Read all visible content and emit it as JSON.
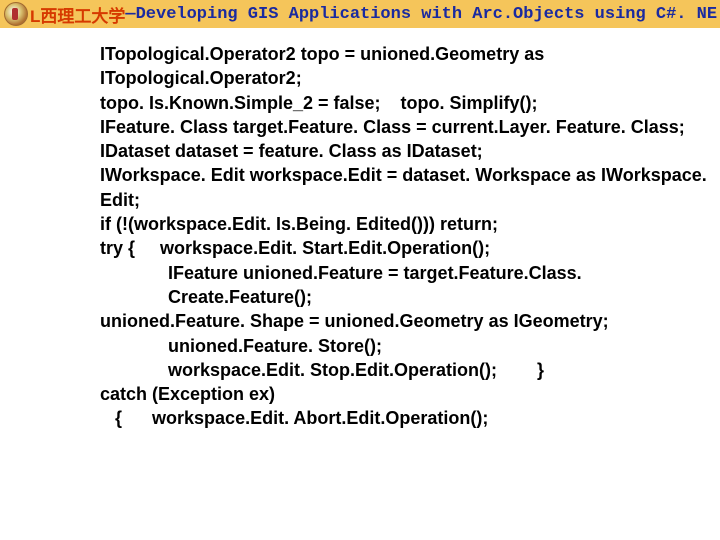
{
  "header": {
    "cn": "L西理工大学",
    "sep": " — ",
    "en": "Developing GIS Applications with Arc.Objects using C#. NE"
  },
  "code": [
    {
      "t": "ITopological.Operator2 topo = unioned.Geometry as ITopological.Operator2;",
      "i": 0
    },
    {
      "t": "topo. Is.Known.Simple_2 = false;    topo. Simplify();",
      "i": 0
    },
    {
      "t": "IFeature. Class target.Feature. Class = current.Layer. Feature. Class;",
      "i": 0
    },
    {
      "t": "IDataset dataset = feature. Class as IDataset;",
      "i": 0
    },
    {
      "t": "IWorkspace. Edit workspace.Edit = dataset. Workspace as IWorkspace. Edit;",
      "i": 0
    },
    {
      "t": "if (!(workspace.Edit. Is.Being. Edited())) return;",
      "i": 0
    },
    {
      "t": "try {     workspace.Edit. Start.Edit.Operation();",
      "i": 0
    },
    {
      "t": "IFeature unioned.Feature = target.Feature.Class. Create.Feature();",
      "i": 2
    },
    {
      "t": "unioned.Feature. Shape = unioned.Geometry as IGeometry;",
      "i": 2,
      "hang": true
    },
    {
      "t": "unioned.Feature. Store();",
      "i": 2
    },
    {
      "t": "workspace.Edit. Stop.Edit.Operation();        }",
      "i": 2
    },
    {
      "t": "catch (Exception ex)",
      "i": 0
    },
    {
      "t": "   {      workspace.Edit. Abort.Edit.Operation();",
      "i": 0
    }
  ]
}
